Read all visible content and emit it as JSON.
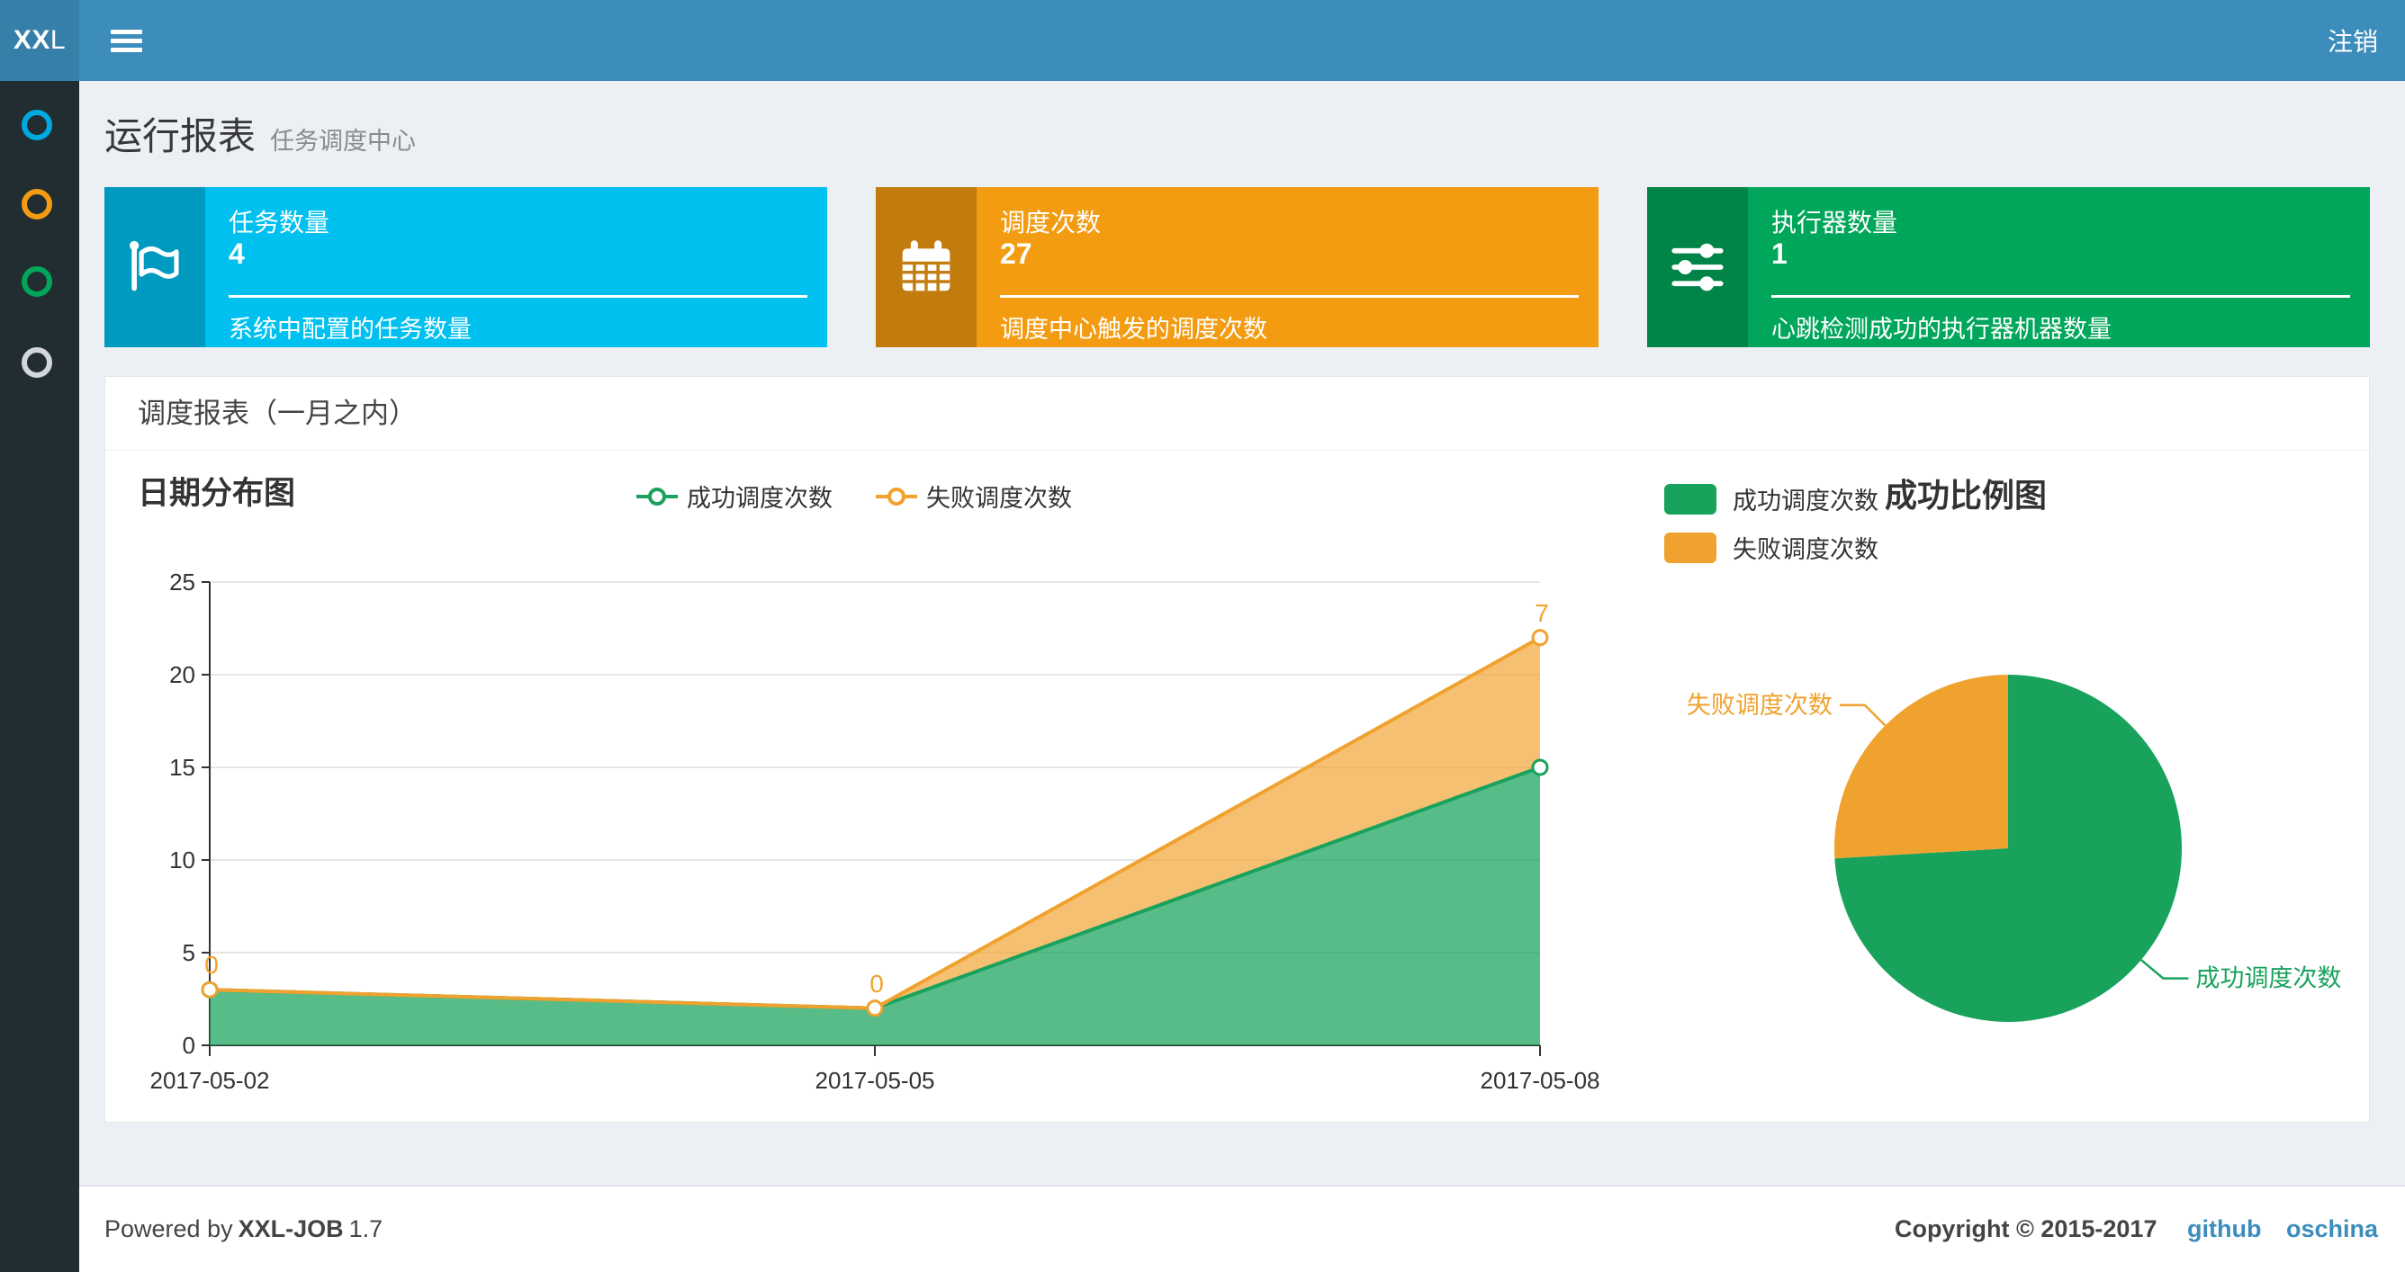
{
  "navbar": {
    "logo": "XXL",
    "logout_label": "注销"
  },
  "sidebar": {
    "items": [
      {
        "icon": "circle-outline-icon",
        "color": "#00a9e0"
      },
      {
        "icon": "circle-outline-icon",
        "color": "#f39c12"
      },
      {
        "icon": "circle-outline-icon",
        "color": "#00a65a"
      },
      {
        "icon": "circle-outline-icon",
        "color": "#d2d6de"
      }
    ]
  },
  "page_header": {
    "title": "运行报表",
    "subtitle": "任务调度中心"
  },
  "info_boxes": [
    {
      "title": "任务数量",
      "value": "4",
      "desc": "系统中配置的任务数量",
      "bg": "#00c0ef",
      "icon": "flag-icon"
    },
    {
      "title": "调度次数",
      "value": "27",
      "desc": "调度中心触发的调度次数",
      "bg": "#f39c12",
      "icon": "calendar-icon"
    },
    {
      "title": "执行器数量",
      "value": "1",
      "desc": "心跳检测成功的执行器机器数量",
      "bg": "#00a65a",
      "icon": "sliders-icon"
    }
  ],
  "panel": {
    "title": "调度报表（一月之内）"
  },
  "chart_data": [
    {
      "type": "area",
      "stacked": true,
      "title": "日期分布图",
      "categories": [
        "2017-05-02",
        "2017-05-05",
        "2017-05-08"
      ],
      "series": [
        {
          "name": "成功调度次数",
          "color": "#18a25c",
          "values": [
            3,
            2,
            15
          ]
        },
        {
          "name": "失败调度次数",
          "color": "#f0a22e",
          "values": [
            0,
            0,
            7
          ]
        }
      ],
      "point_labels_series": "失败调度次数",
      "point_labels": [
        0,
        0,
        7
      ],
      "ylim": [
        0,
        25
      ],
      "yticks": [
        0,
        5,
        10,
        15,
        20,
        25
      ],
      "grid": true,
      "legend_position": "top-center"
    },
    {
      "type": "pie",
      "title": "成功比例图",
      "slices": [
        {
          "name": "成功调度次数",
          "value": 20,
          "color": "#18a25c"
        },
        {
          "name": "失败调度次数",
          "value": 7,
          "color": "#f0a22e"
        }
      ],
      "legend_position": "top-left"
    }
  ],
  "footer": {
    "powered_prefix": "Powered by",
    "product": "XXL-JOB",
    "version": "1.7",
    "copyright": "Copyright © 2015-2017",
    "links": [
      {
        "label": "github"
      },
      {
        "label": "oschina"
      }
    ]
  }
}
